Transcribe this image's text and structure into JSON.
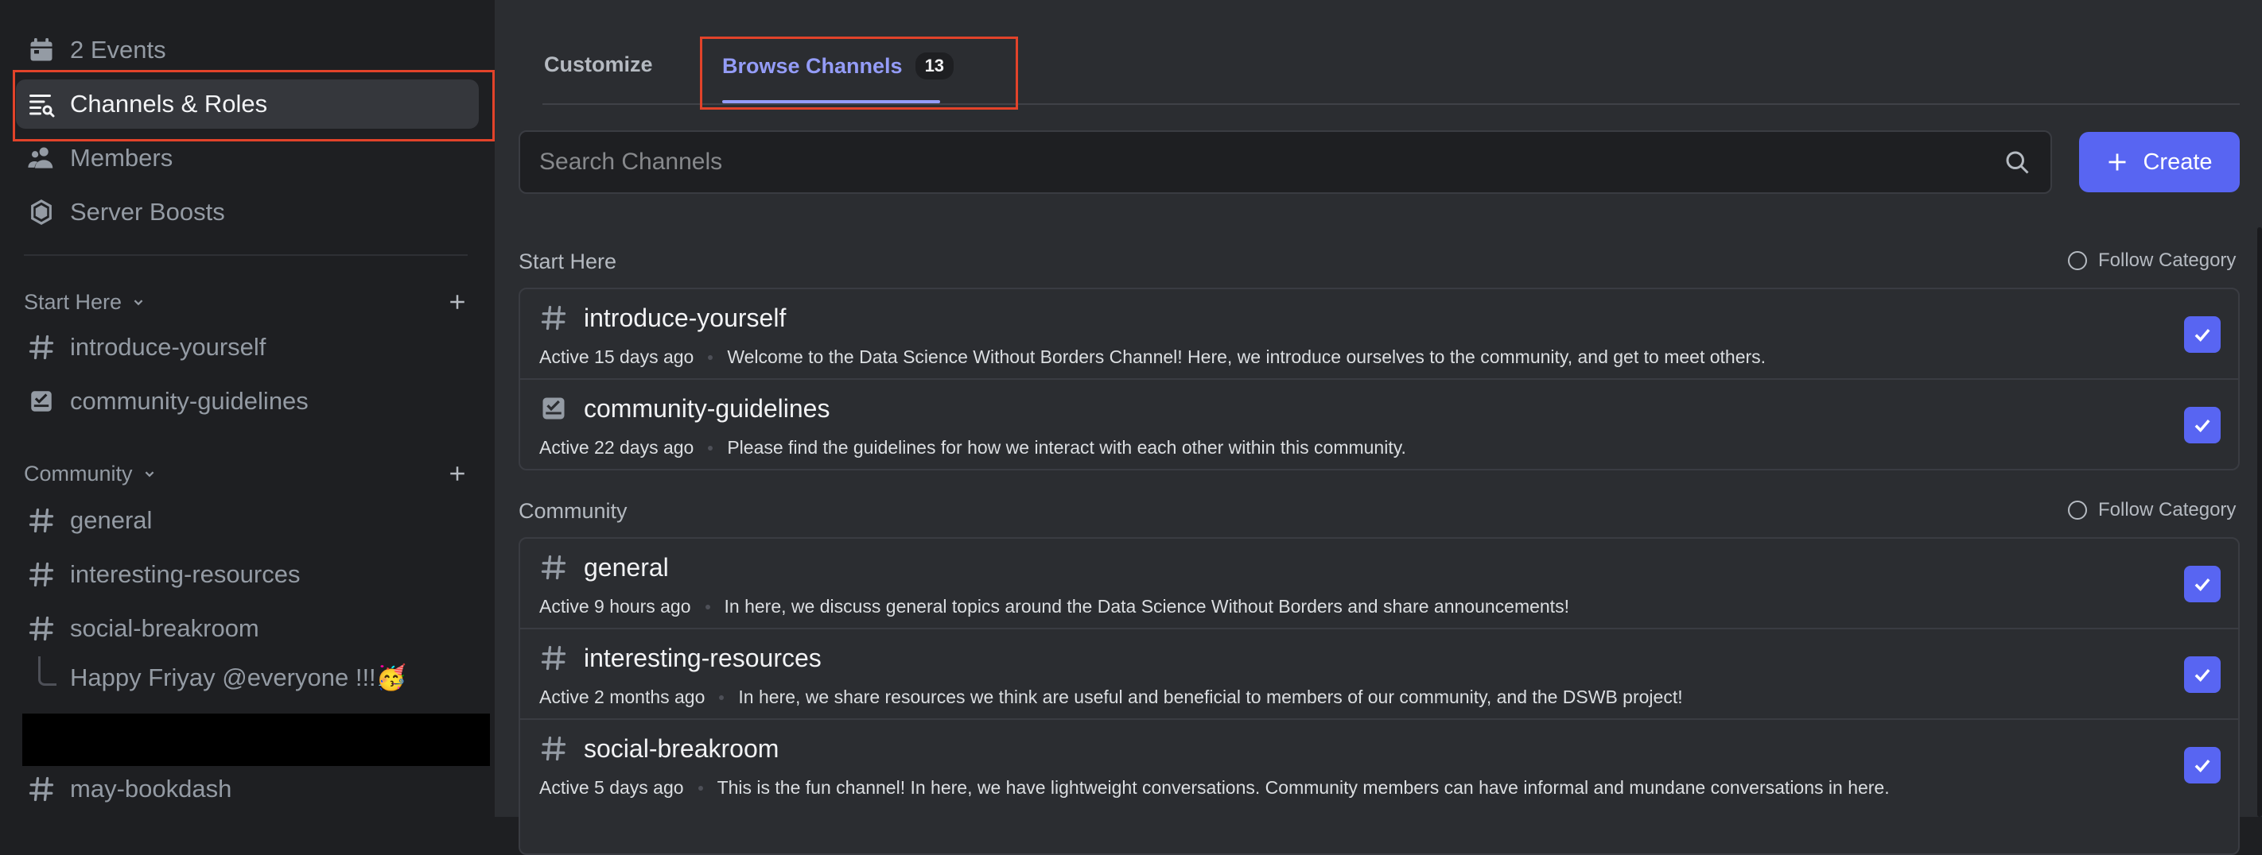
{
  "sidebar": {
    "nav": [
      {
        "label": "2 Events",
        "icon": "calendar-icon"
      },
      {
        "label": "Channels & Roles",
        "icon": "channels-browse-icon",
        "active": true
      },
      {
        "label": "Members",
        "icon": "members-icon"
      },
      {
        "label": "Server Boosts",
        "icon": "boost-icon"
      }
    ],
    "categories": [
      {
        "name": "Start Here",
        "channels": [
          {
            "label": "introduce-yourself",
            "icon": "hashtag-icon"
          },
          {
            "label": "community-guidelines",
            "icon": "rules-icon"
          }
        ]
      },
      {
        "name": "Community",
        "channels": [
          {
            "label": "general",
            "icon": "hashtag-icon"
          },
          {
            "label": "interesting-resources",
            "icon": "hashtag-icon"
          },
          {
            "label": "social-breakroom",
            "icon": "hashtag-icon"
          }
        ],
        "thread": "Happy Friyay @everyone !!!🥳"
      }
    ],
    "bottom_channel": {
      "label": "may-bookdash",
      "icon": "hashtag-icon"
    }
  },
  "main": {
    "tabs": [
      {
        "label": "Customize"
      },
      {
        "label": "Browse Channels",
        "count": "13",
        "active": true
      }
    ],
    "search": {
      "placeholder": "Search Channels"
    },
    "create_label": "Create",
    "follow_label": "Follow Category",
    "sections": [
      {
        "title": "Start Here",
        "channels": [
          {
            "name": "introduce-yourself",
            "icon": "hashtag-icon",
            "active": "Active 15 days ago",
            "description": "Welcome to the Data Science Without Borders Channel! Here, we introduce ourselves to the community, and get to meet others.",
            "checked": true
          },
          {
            "name": "community-guidelines",
            "icon": "rules-icon",
            "active": "Active 22 days ago",
            "description": "Please find the guidelines for how we interact with each other within this community.",
            "checked": true
          }
        ]
      },
      {
        "title": "Community",
        "channels": [
          {
            "name": "general",
            "icon": "hashtag-icon",
            "active": "Active 9 hours ago",
            "description": "In here, we discuss general topics around the Data Science Without Borders and share announcements!",
            "checked": true
          },
          {
            "name": "interesting-resources",
            "icon": "hashtag-icon",
            "active": "Active 2 months ago",
            "description": "In here, we share resources we think are useful and beneficial to members of our community, and the DSWB project!",
            "checked": true
          },
          {
            "name": "social-breakroom",
            "icon": "hashtag-icon",
            "active": "Active 5 days ago",
            "description": "This is the fun channel! In here, we have lightweight conversations. Community members can have informal and mundane conversations in here.",
            "checked": true
          }
        ]
      }
    ]
  },
  "colors": {
    "accent": "#5865f2",
    "tab_active": "#949cf7",
    "highlight": "#e2432a",
    "background": "#2b2d31",
    "sidebar": "#1e1f22"
  }
}
